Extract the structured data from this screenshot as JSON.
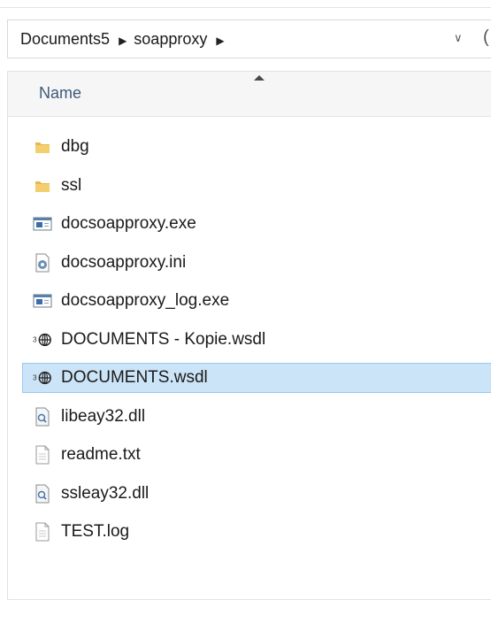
{
  "breadcrumb": {
    "items": [
      "Documents5",
      "soapproxy"
    ],
    "separator": "▶",
    "dropdown": "∨"
  },
  "list": {
    "column_name": "Name",
    "files": [
      {
        "name": "dbg",
        "icon": "folder-icon"
      },
      {
        "name": "ssl",
        "icon": "folder-icon"
      },
      {
        "name": "docsoapproxy.exe",
        "icon": "exe-icon"
      },
      {
        "name": "docsoapproxy.ini",
        "icon": "config-file-icon"
      },
      {
        "name": "docsoapproxy_log.exe",
        "icon": "exe-icon"
      },
      {
        "name": "DOCUMENTS - Kopie.wsdl",
        "icon": "wsdl-file-icon"
      },
      {
        "name": "DOCUMENTS.wsdl",
        "icon": "wsdl-file-icon",
        "selected": true
      },
      {
        "name": "libeay32.dll",
        "icon": "dll-file-icon"
      },
      {
        "name": "readme.txt",
        "icon": "text-file-icon"
      },
      {
        "name": "ssleay32.dll",
        "icon": "dll-file-icon"
      },
      {
        "name": "TEST.log",
        "icon": "text-file-icon"
      }
    ]
  },
  "colors": {
    "selection_bg": "#cce4f7",
    "selection_border": "#99c9ef",
    "folder": "#e8b84a",
    "header_text": "#3d5a79"
  }
}
